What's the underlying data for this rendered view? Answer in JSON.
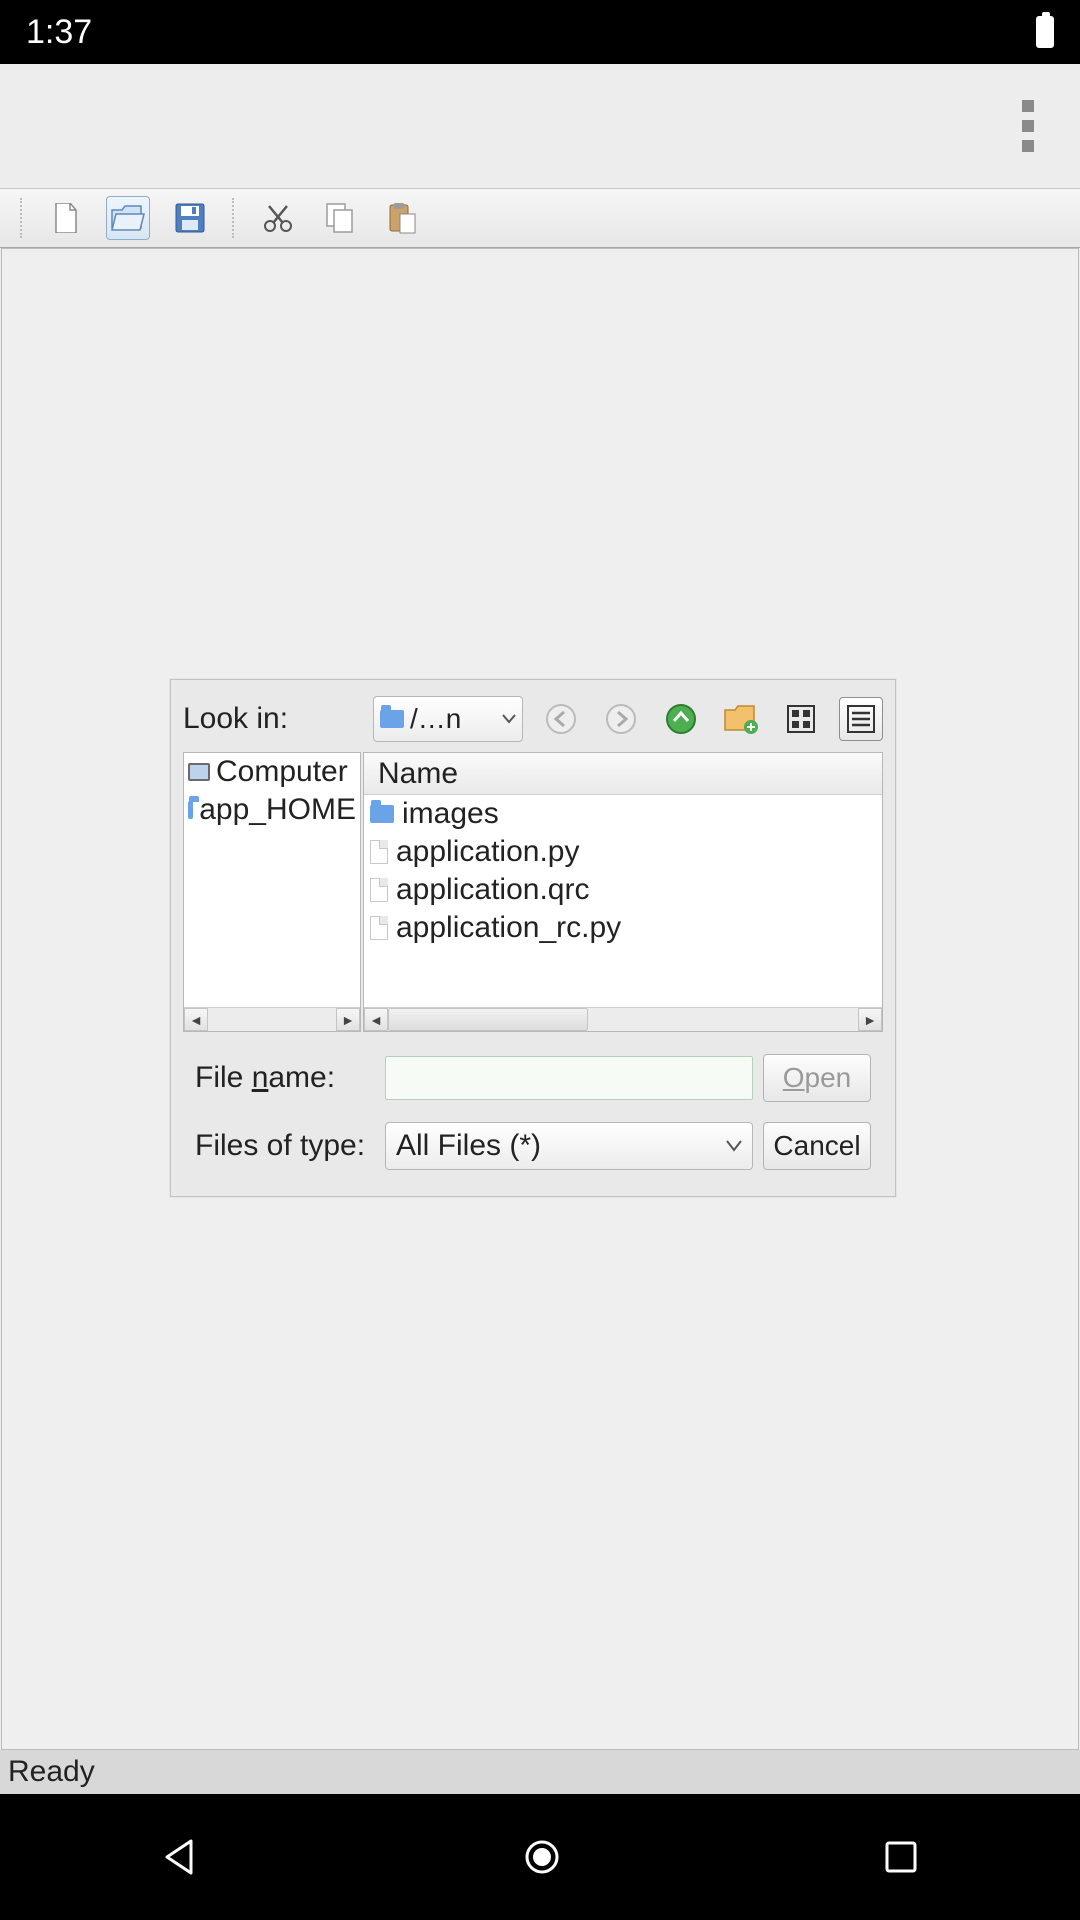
{
  "status_bar": {
    "time": "1:37"
  },
  "app_bar": {},
  "toolbar": {},
  "status_strip": "Ready",
  "dialog": {
    "look_in_label": "Look in:",
    "look_in_value": "/…n",
    "sidebar": {
      "items": [
        {
          "label": "Computer",
          "kind": "computer"
        },
        {
          "label": "app_HOME",
          "kind": "folder"
        }
      ]
    },
    "files": {
      "column_header": "Name",
      "items": [
        {
          "label": "images",
          "kind": "folder"
        },
        {
          "label": "application.py",
          "kind": "file"
        },
        {
          "label": "application.qrc",
          "kind": "file"
        },
        {
          "label": "application_rc.py",
          "kind": "file"
        }
      ]
    },
    "file_name_label_pre": "File ",
    "file_name_label_ul": "n",
    "file_name_label_post": "ame:",
    "file_name_value": "",
    "files_of_type_label": "Files of type:",
    "files_of_type_value": "All Files (*)",
    "open_label_ul": "O",
    "open_label_post": "pen",
    "cancel_label": "Cancel"
  }
}
